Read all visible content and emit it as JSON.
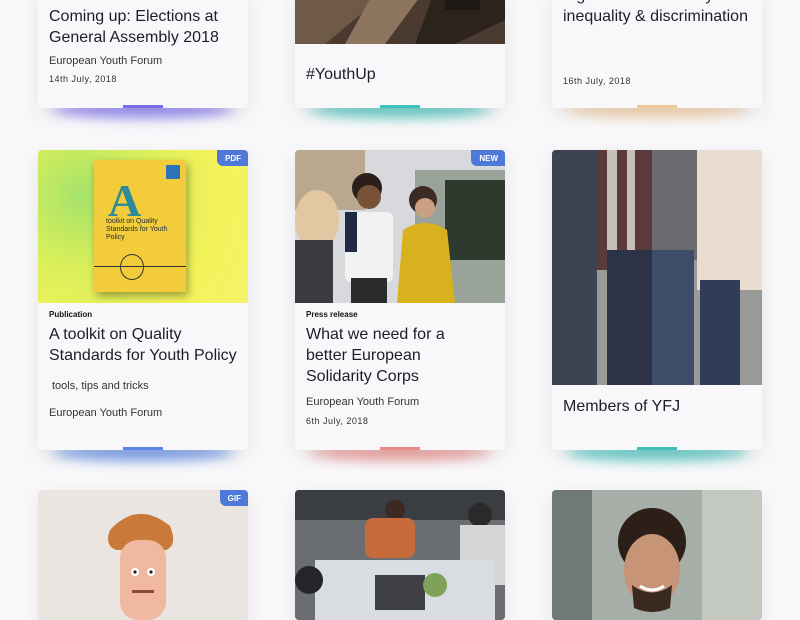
{
  "cards": [
    {
      "title": "Coming up: Elections at General Assembly 2018",
      "author": "European Youth Forum",
      "date": "14th July, 2018"
    },
    {
      "title": "#YouthUp"
    },
    {
      "title": "together to address youth inequality & discrimination",
      "date": "16th July, 2018"
    },
    {
      "badge": "PDF",
      "kind": "Publication",
      "title": "A toolkit on Quality Standards for Youth Policy",
      "subtitle": "tools, tips and tricks",
      "author": "European Youth Forum",
      "cover_text": "toolkit on Quality Standards for Youth Policy",
      "cover_letter": "A"
    },
    {
      "badge": "NEW",
      "kind": "Press release",
      "title": "What we need for a better European Solidarity Corps",
      "author": "European Youth Forum",
      "date": "6th July, 2018"
    },
    {
      "title": "Members of YFJ"
    },
    {
      "badge": "GIF"
    },
    {},
    {}
  ],
  "colors": {
    "purple": "#7b6cf0",
    "teal": "#3fc0bb",
    "peach": "#f2c89a",
    "blue": "#5b87e6",
    "coral": "#e98a86",
    "badge": "#4f79d8"
  }
}
